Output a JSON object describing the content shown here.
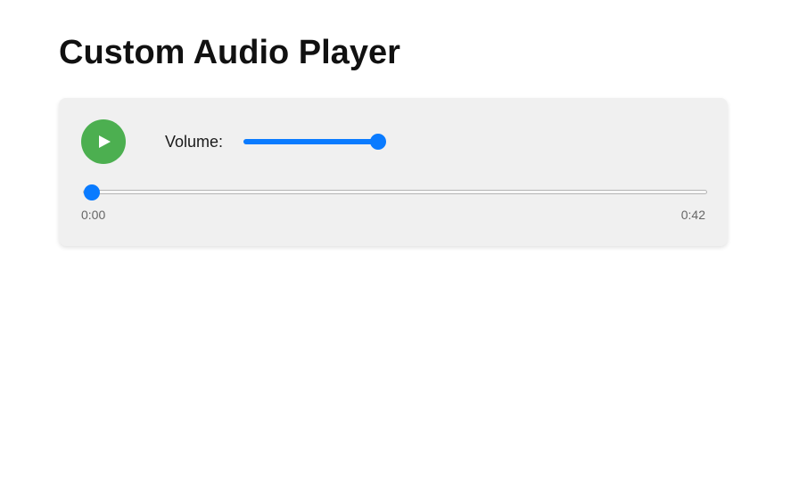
{
  "page": {
    "title": "Custom Audio Player"
  },
  "player": {
    "play_icon": "play-icon",
    "play_button_color": "#4caf50",
    "accent_color": "#0a7bff",
    "volume": {
      "label": "Volume:",
      "level": 1.0
    },
    "progress": {
      "level": 0.0,
      "current_time": "0:00",
      "total_time": "0:42"
    }
  }
}
